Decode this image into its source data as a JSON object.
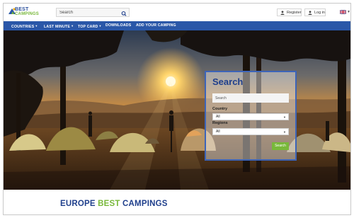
{
  "header": {
    "logo": {
      "line1": "BEST",
      "line2": "CAMPINGS"
    },
    "search": {
      "placeholder": "Search"
    },
    "register_label": "Register",
    "login_label": "Log in",
    "language_flag": "uk-flag-icon"
  },
  "nav": {
    "items": [
      {
        "label": "COUNTRIES",
        "dropdown": true
      },
      {
        "label": "LAST MINUTE",
        "dropdown": true
      },
      {
        "label": "TOP CARD",
        "dropdown": true
      },
      {
        "label": "DOWNLOADS",
        "dropdown": false
      },
      {
        "label": "ADD YOUR CAMPING",
        "dropdown": false
      }
    ]
  },
  "search_panel": {
    "title": "Search",
    "search_placeholder": "Search",
    "country_label": "Country",
    "country_value": "All",
    "regions_label": "Regions",
    "regions_value": "All",
    "button_label": "Search"
  },
  "brand_title": {
    "part1": "EUROPE ",
    "part2": "BEST",
    "part3": " CAMPINGS"
  },
  "colors": {
    "brand_blue": "#2a57a8",
    "title_blue": "#1f3f8c",
    "accent_green": "#78b83a"
  }
}
